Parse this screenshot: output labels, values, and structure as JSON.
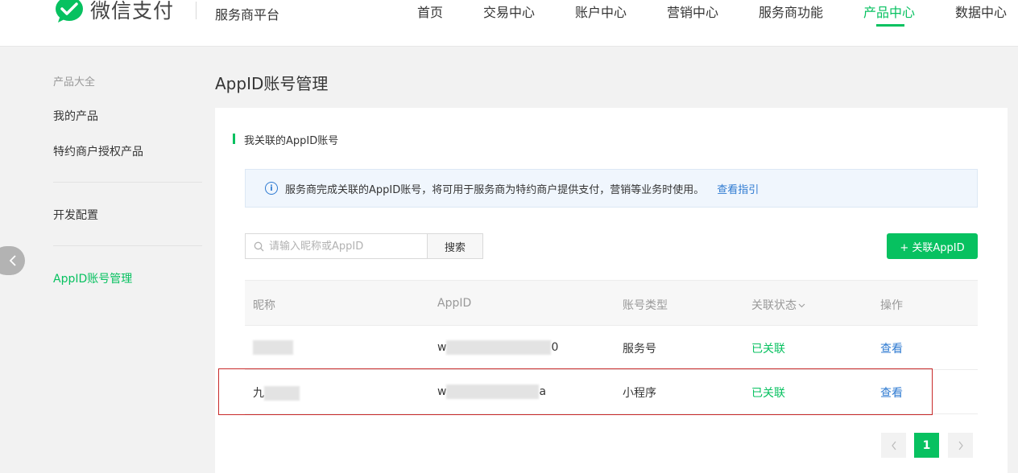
{
  "header": {
    "brand": "微信支付",
    "platform": "服务商平台",
    "nav": [
      {
        "label": "首页"
      },
      {
        "label": "交易中心"
      },
      {
        "label": "账户中心"
      },
      {
        "label": "营销中心"
      },
      {
        "label": "服务商功能"
      },
      {
        "label": "产品中心",
        "active": true
      },
      {
        "label": "数据中心"
      }
    ]
  },
  "sidebar": {
    "heading": "产品大全",
    "items": [
      {
        "label": "我的产品"
      },
      {
        "label": "特约商户授权产品"
      },
      {
        "label": "开发配置"
      },
      {
        "label": "AppID账号管理",
        "active": true
      }
    ]
  },
  "main": {
    "title": "AppID账号管理",
    "section_title": "我关联的AppID账号",
    "notice": {
      "text": "服务商完成关联的AppID账号，将可用于服务商为特约商户提供支付，营销等业务时使用。",
      "link": "查看指引"
    },
    "search": {
      "placeholder": "请输入昵称或AppID",
      "button": "搜索"
    },
    "add_button": "+ 关联AppID",
    "table": {
      "headers": [
        "昵称",
        "AppID",
        "账号类型",
        "关联状态",
        "操作"
      ],
      "sort_icon": "chevron-down-icon",
      "rows": [
        {
          "nickname_visible": "",
          "appid_start": "w",
          "appid_end": "0",
          "type": "服务号",
          "status": "已关联",
          "action": "查看"
        },
        {
          "nickname_visible": "九",
          "appid_start": "w",
          "appid_end": "a",
          "type": "小程序",
          "status": "已关联",
          "action": "查看"
        }
      ]
    },
    "pagination": {
      "current": "1"
    }
  },
  "colors": {
    "accent": "#07c160",
    "link": "#2e7ad1",
    "highlight": "#c82a2a"
  }
}
